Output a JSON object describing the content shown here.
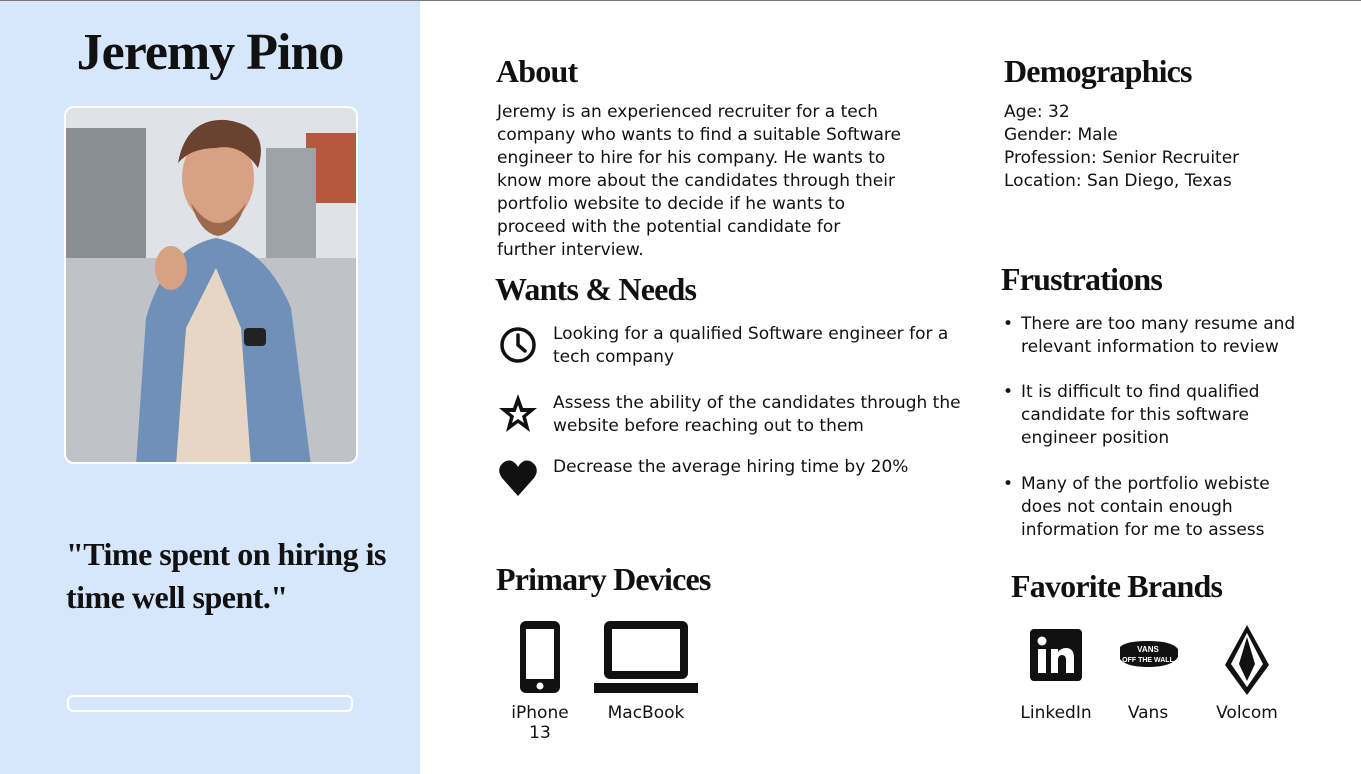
{
  "persona": {
    "name": "Jeremy Pino",
    "quote": "\"Time spent on hiring is time well spent.\""
  },
  "about": {
    "heading": "About",
    "lines": [
      "Jeremy is an experienced recruiter for a tech",
      "company who wants to find a suitable Software",
      "engineer to hire for his company. He wants to",
      "know more about the candidates through their",
      "portfolio website to decide if he wants to",
      "proceed with the potential candidate for",
      "further interview."
    ]
  },
  "demographics": {
    "heading": "Demographics",
    "items": [
      "Age: 32",
      "Gender: Male",
      "Profession: Senior Recruiter",
      "Location: San Diego, Texas"
    ]
  },
  "wants": {
    "heading": "Wants & Needs",
    "items": [
      {
        "icon": "clock-icon",
        "lines": [
          "Looking for a qualified Software engineer for a",
          "tech company"
        ]
      },
      {
        "icon": "star-icon",
        "lines": [
          "Assess the ability of the candidates through the",
          "website before reaching out to them"
        ]
      },
      {
        "icon": "heart-icon",
        "lines": [
          "Decrease the average hiring time by 20%"
        ]
      }
    ]
  },
  "frustrations": {
    "heading": "Frustrations",
    "bullet": "•",
    "items": [
      {
        "lines": [
          "There are too many resume and",
          "relevant information to review"
        ]
      },
      {
        "lines": [
          "It is difficult to find qualified",
          "candidate for this software",
          "engineer position"
        ]
      },
      {
        "lines": [
          "Many of the portfolio webiste",
          "does not contain enough",
          "information for me to assess"
        ]
      }
    ]
  },
  "devices": {
    "heading": "Primary Devices",
    "items": [
      {
        "label": "iPhone 13",
        "icon": "smartphone-icon"
      },
      {
        "label": "MacBook",
        "icon": "laptop-icon"
      }
    ]
  },
  "brands": {
    "heading": "Favorite Brands",
    "items": [
      {
        "label": "LinkedIn",
        "icon": "linkedin-logo"
      },
      {
        "label": "Vans",
        "icon": "vans-logo",
        "logo_text_top": "VANS",
        "logo_text_bottom": "OFF THE WALL"
      },
      {
        "label": "Volcom",
        "icon": "volcom-logo"
      }
    ]
  },
  "colors": {
    "left_panel": "#d6e6fb",
    "text": "#111111"
  }
}
